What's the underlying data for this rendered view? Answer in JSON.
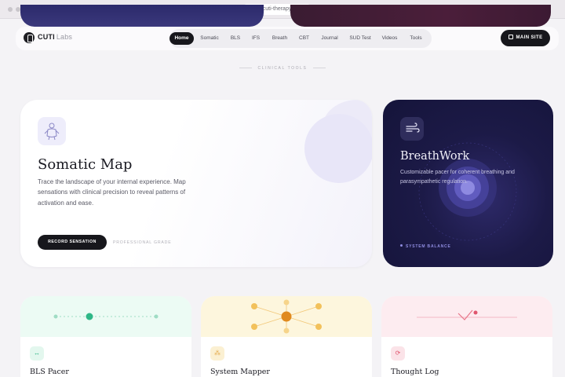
{
  "browser": {
    "url": "labs.cuti-therapy.com"
  },
  "brand": {
    "name": "CUTI",
    "suffix": "Labs"
  },
  "nav": {
    "items": [
      "Home",
      "Somatic",
      "BLS",
      "IFS",
      "Breath",
      "CBT",
      "Journal",
      "SUD Test",
      "Videos",
      "Tools"
    ],
    "active": "Home",
    "main_site_label": "MAIN SITE"
  },
  "section_label": "CLINICAL TOOLS",
  "somatic": {
    "title": "Somatic Map",
    "description": "Trace the landscape of your internal experience. Map sensations with clinical precision to reveal patterns of activation and ease.",
    "button": "RECORD SENSATION",
    "badge": "PROFESSIONAL GRADE",
    "icon": "person-body-icon"
  },
  "breathwork": {
    "title": "BreathWork",
    "description": "Customizable pacer for coherent breathing and parasympathetic regulation.",
    "status": "SYSTEM BALANCE",
    "icon": "wind-icon"
  },
  "tools": [
    {
      "name": "BLS Pacer",
      "icon": "arrows-horizontal-icon",
      "accent": "#22b07d"
    },
    {
      "name": "System Mapper",
      "icon": "network-icon",
      "accent": "#e0a13a"
    },
    {
      "name": "Thought Log",
      "icon": "refresh-icon",
      "accent": "#e0566e"
    }
  ],
  "colors": {
    "dark": "#17171c",
    "breath_bg": "#1c1a47",
    "bls_band": "#eafaf2",
    "mapper_band": "#fdf5dc",
    "thought_band": "#fde9ee"
  }
}
